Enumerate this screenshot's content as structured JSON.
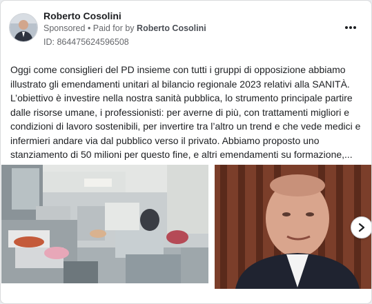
{
  "post": {
    "author": "Roberto Cosolini",
    "sponsored_label": "Sponsored",
    "separator": " • ",
    "paid_for_label": "Paid for by",
    "paid_for_name": "Roberto Cosolini",
    "ad_id": "ID: 864475624596508",
    "more_icon": "three-dots-icon",
    "body": "Oggi come consiglieri del PD insieme con tutti i gruppi di opposizione abbiamo illustrato gli emendamenti unitari al bilancio regionale 2023 relativi alla SANITÀ. L’obiettivo è investire nella nostra sanità pubblica, lo strumento principale partire dalle risorse umane, i professionisti: per averne di più, con trattamenti migliori e condizioni di lavoro sostenibili, per invertire tra l’altro un trend e che vede medici e infermieri andare via dal pubblico verso il privato. Abbiamo proposto uno stanziamento di 50 milioni per questo fine, e altri emendamenti su formazione,..."
  },
  "carousel": {
    "next_icon": "chevron-right-icon"
  }
}
